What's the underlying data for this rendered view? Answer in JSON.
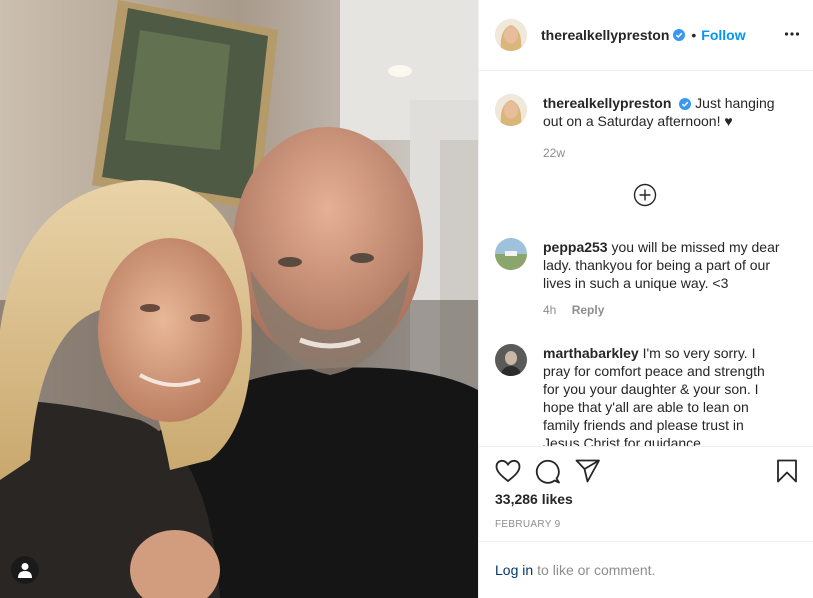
{
  "post": {
    "username": "therealkellypreston",
    "follow_label": "Follow",
    "dot": "•"
  },
  "caption": {
    "username": "therealkellypreston",
    "text": "Just hanging out on a Saturday afternoon! ♥",
    "time": "22w"
  },
  "comments": [
    {
      "username": "peppa253",
      "text": "you will be missed my dear lady. thankyou for being a part of our lives in such a unique way. <3",
      "time": "4h",
      "reply_label": "Reply"
    },
    {
      "username": "marthabarkley",
      "text": "I'm so very sorry. I pray for comfort peace and strength for you your daughter & your son. I hope that y'all are able to lean on family friends and please trust in Jesus Christ for guidance",
      "time": "",
      "reply_label": ""
    }
  ],
  "likes": "33,286 likes",
  "date": "FEBRUARY 9",
  "login": {
    "link": "Log in",
    "rest": "to like or comment."
  },
  "colors": {
    "link": "#0095f6",
    "verified": "#3897f0",
    "muted": "#8e8e8e"
  },
  "icons": [
    "user-tag-icon",
    "verified-icon",
    "more-options-icon",
    "load-more-comments-icon",
    "heart-icon",
    "comment-icon",
    "share-icon",
    "bookmark-icon"
  ]
}
